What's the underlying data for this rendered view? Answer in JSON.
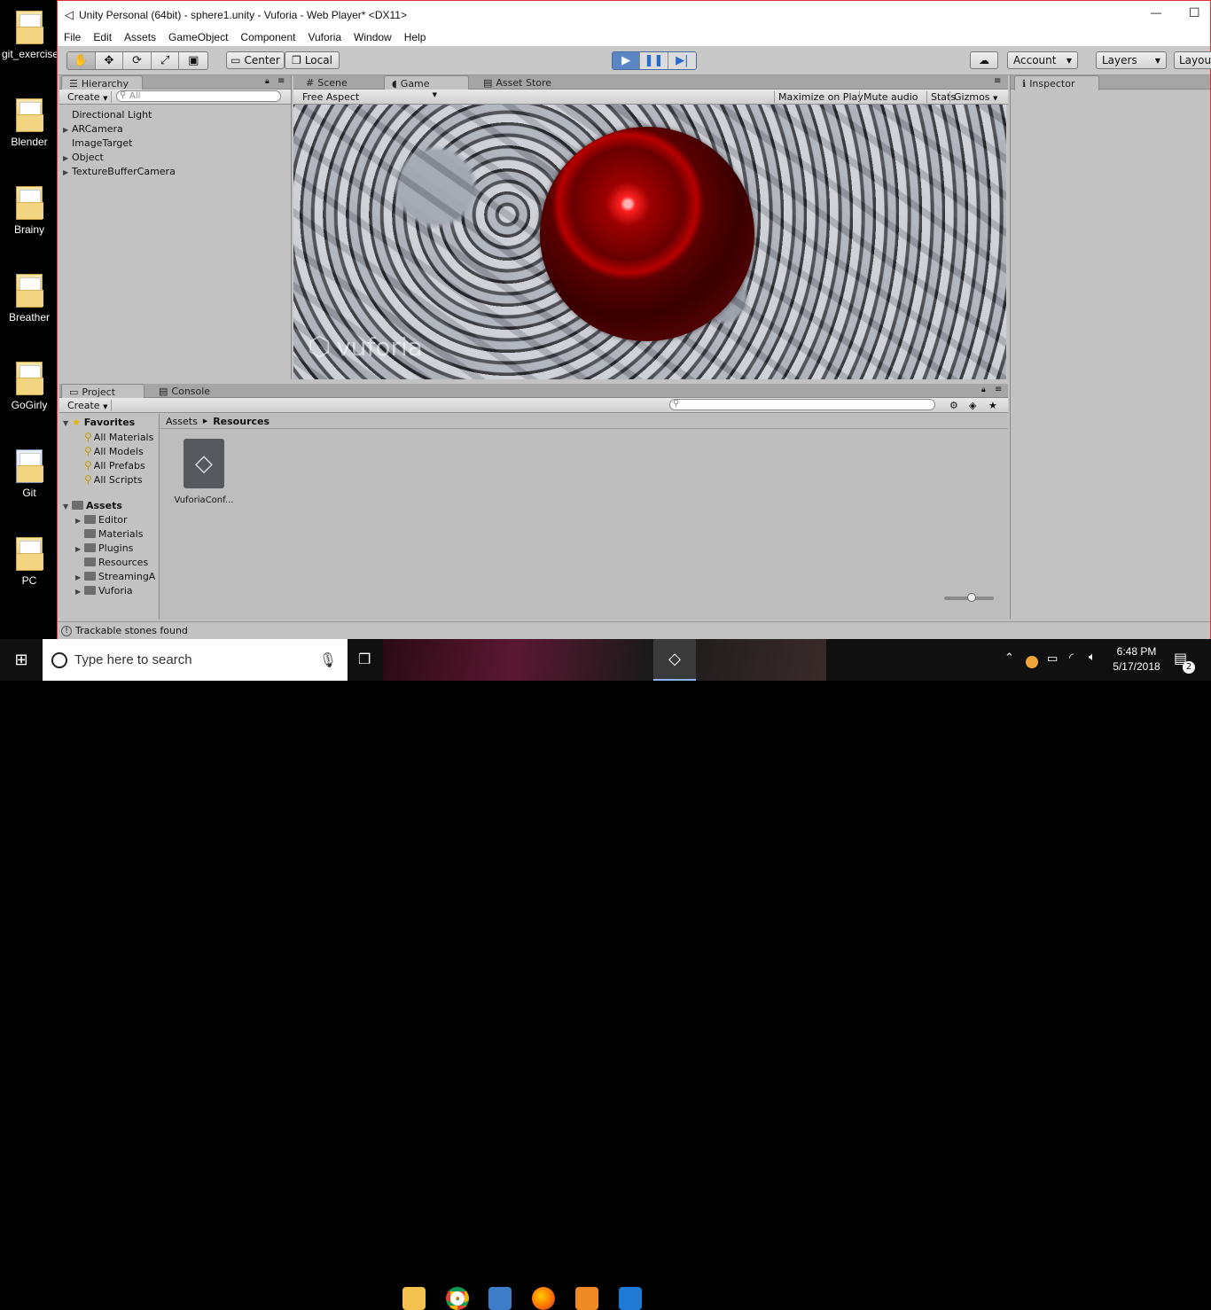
{
  "desktop": {
    "icons": [
      {
        "label": "git_exercise"
      },
      {
        "label": "Blender"
      },
      {
        "label": "Brainy"
      },
      {
        "label": "Breather"
      },
      {
        "label": "GoGirly"
      },
      {
        "label": "Git"
      },
      {
        "label": "PC"
      }
    ]
  },
  "window": {
    "title": "Unity Personal (64bit) - sphere1.unity - Vuforia - Web Player* <DX11>",
    "minimize": "—",
    "maximize": "☐"
  },
  "menu": [
    "File",
    "Edit",
    "Assets",
    "GameObject",
    "Component",
    "Vuforia",
    "Window",
    "Help"
  ],
  "toolbar": {
    "center": "Center",
    "local": "Local",
    "account": "Account",
    "layers": "Layers",
    "layout": "Layout"
  },
  "hierarchy": {
    "tab": "Hierarchy",
    "create": "Create",
    "search_placeholder": "All",
    "items": [
      {
        "label": "Directional Light"
      },
      {
        "label": "ARCamera"
      },
      {
        "label": "ImageTarget"
      },
      {
        "label": "Object"
      },
      {
        "label": "TextureBufferCamera"
      }
    ]
  },
  "center_tabs": {
    "scene": "Scene",
    "game": "Game",
    "asset_store": "Asset Store"
  },
  "game": {
    "aspect": "Free Aspect",
    "maximize": "Maximize on Play",
    "mute": "Mute audio",
    "stats": "Stats",
    "gizmos": "Gizmos",
    "watermark": "vuforia"
  },
  "inspector": {
    "tab": "Inspector"
  },
  "project": {
    "tab_project": "Project",
    "tab_console": "Console",
    "create": "Create",
    "favorites": {
      "label": "Favorites",
      "items": [
        "All Materials",
        "All Models",
        "All Prefabs",
        "All Scripts"
      ]
    },
    "assets": {
      "label": "Assets",
      "items": [
        {
          "label": "Editor"
        },
        {
          "label": "Materials"
        },
        {
          "label": "Plugins"
        },
        {
          "label": "Resources"
        },
        {
          "label": "StreamingA"
        },
        {
          "label": "Vuforia"
        }
      ]
    },
    "breadcrumb": [
      "Assets",
      "Resources"
    ],
    "file": "VuforiaConf..."
  },
  "status": "Trackable stones found",
  "taskbar": {
    "search_placeholder": "Type here to search",
    "time": "6:48 PM",
    "date": "5/17/2018",
    "notifications": "2"
  }
}
